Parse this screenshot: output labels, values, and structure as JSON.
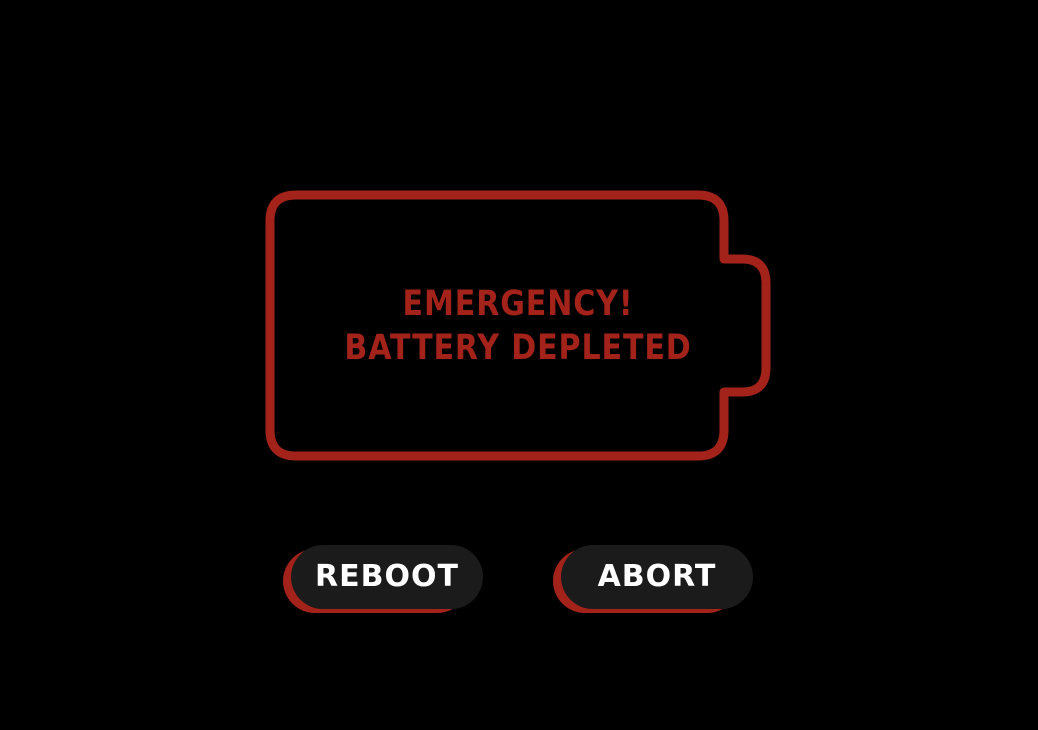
{
  "alert": {
    "line1": "EMERGENCY!",
    "line2": "BATTERY DEPLETED"
  },
  "buttons": {
    "reboot_label": "REBOOT",
    "abort_label": "ABORT"
  },
  "battery": {
    "icon": "empty-battery-icon",
    "charge_level": 0
  },
  "colors": {
    "background": "#000000",
    "accent": "#a3231b",
    "button_face": "#1b1b1b",
    "button_text": "#ffffff"
  }
}
